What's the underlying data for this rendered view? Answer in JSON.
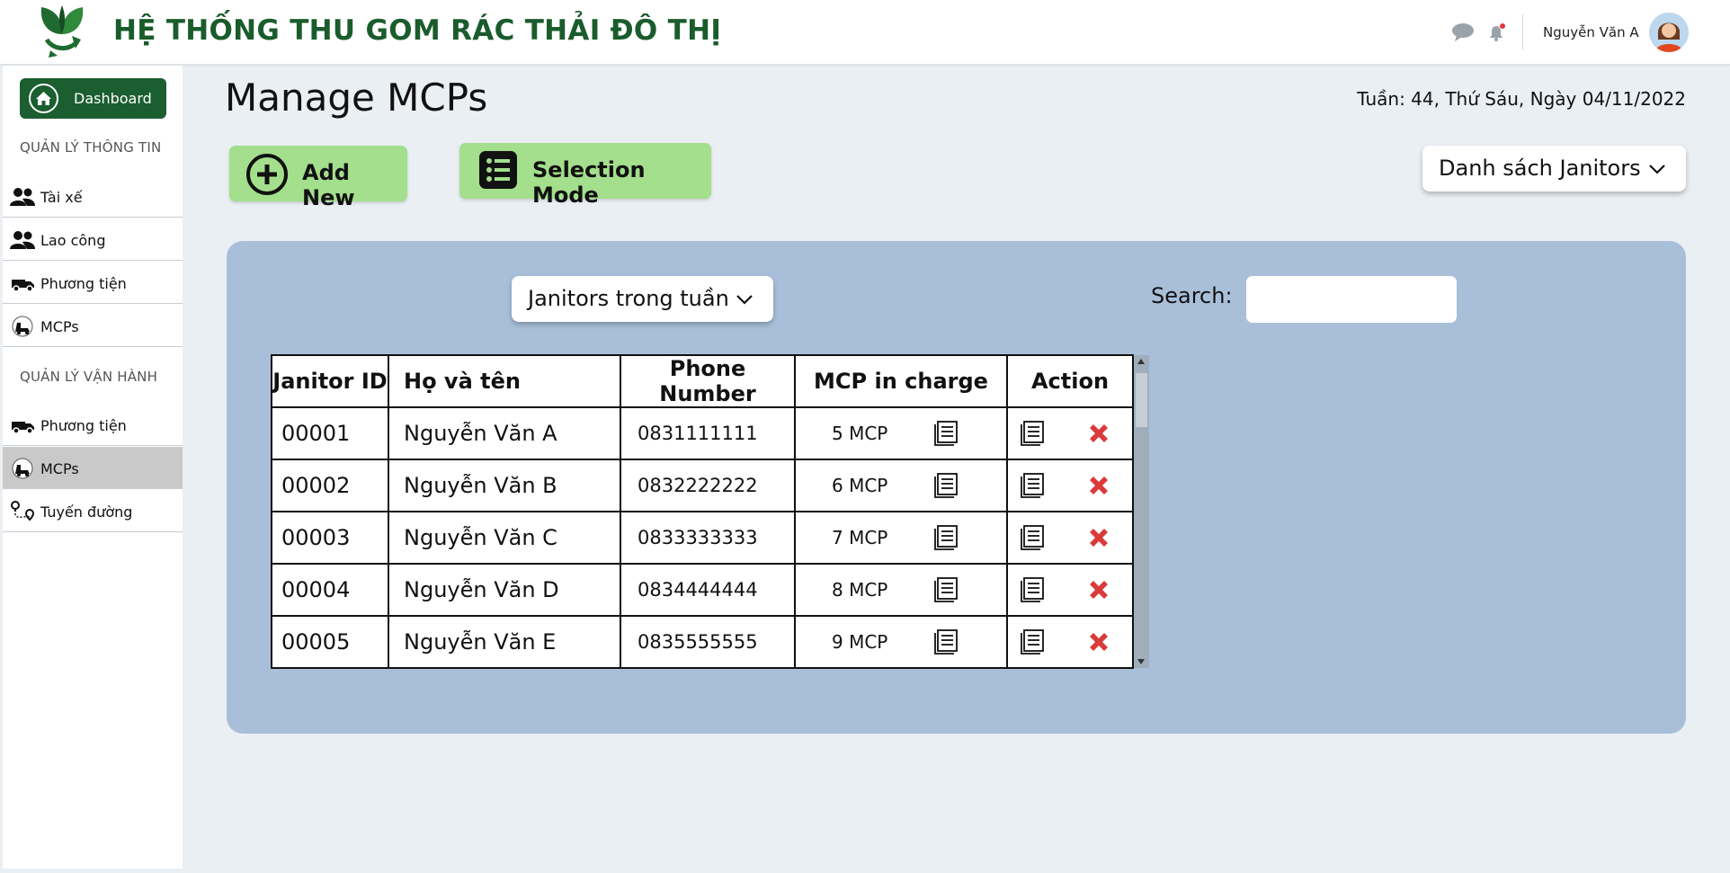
{
  "app": {
    "title": "HỆ THỐNG THU GOM RÁC THẢI ĐÔ THỊ",
    "brand_color": "#1b5e30"
  },
  "header": {
    "icons": [
      "chat-icon",
      "bell-icon"
    ],
    "user_name": "Nguyễn Văn A"
  },
  "sidebar": {
    "dashboard_label": "Dashboard",
    "section_info": "QUẢN LÝ THÔNG TIN",
    "section_ops": "QUẢN LÝ VẬN HÀNH",
    "info_items": [
      {
        "label": "Tài xế",
        "icon": "users-icon"
      },
      {
        "label": "Lao công",
        "icon": "users-icon"
      },
      {
        "label": "Phương tiện",
        "icon": "truck-icon"
      },
      {
        "label": "MCPs",
        "icon": "mcp-icon"
      }
    ],
    "ops_items": [
      {
        "label": "Phương tiện",
        "icon": "truck-icon"
      },
      {
        "label": "MCPs",
        "icon": "mcp-icon",
        "active": true
      },
      {
        "label": "Tuyến đường",
        "icon": "route-icon"
      }
    ]
  },
  "main": {
    "page_title": "Manage MCPs",
    "date_text": "Tuần: 44, Thứ Sáu, Ngày 04/11/2022",
    "add_new_label": "Add New",
    "selection_mode_label": "Selection Mode",
    "list_dropdown": "Danh sách Janitors",
    "week_dropdown": "Janitors trong tuần",
    "search_label": "Search:",
    "search_value": "",
    "button_color": "#a3df8c",
    "panel_color": "#a9bfd9"
  },
  "table": {
    "headers": [
      "Janitor ID",
      "Họ và tên",
      "Phone Number",
      "MCP in charge",
      "Action"
    ],
    "rows": [
      {
        "id": "00001",
        "name": "Nguyễn Văn A",
        "phone": "0831111111",
        "mcp": "5 MCP"
      },
      {
        "id": "00002",
        "name": "Nguyễn Văn B",
        "phone": "0832222222",
        "mcp": "6 MCP"
      },
      {
        "id": "00003",
        "name": "Nguyễn Văn C",
        "phone": "0833333333",
        "mcp": "7 MCP"
      },
      {
        "id": "00004",
        "name": "Nguyễn Văn D",
        "phone": "0834444444",
        "mcp": "8 MCP"
      },
      {
        "id": "00005",
        "name": "Nguyễn Văn E",
        "phone": "0835555555",
        "mcp": "9 MCP"
      }
    ]
  }
}
